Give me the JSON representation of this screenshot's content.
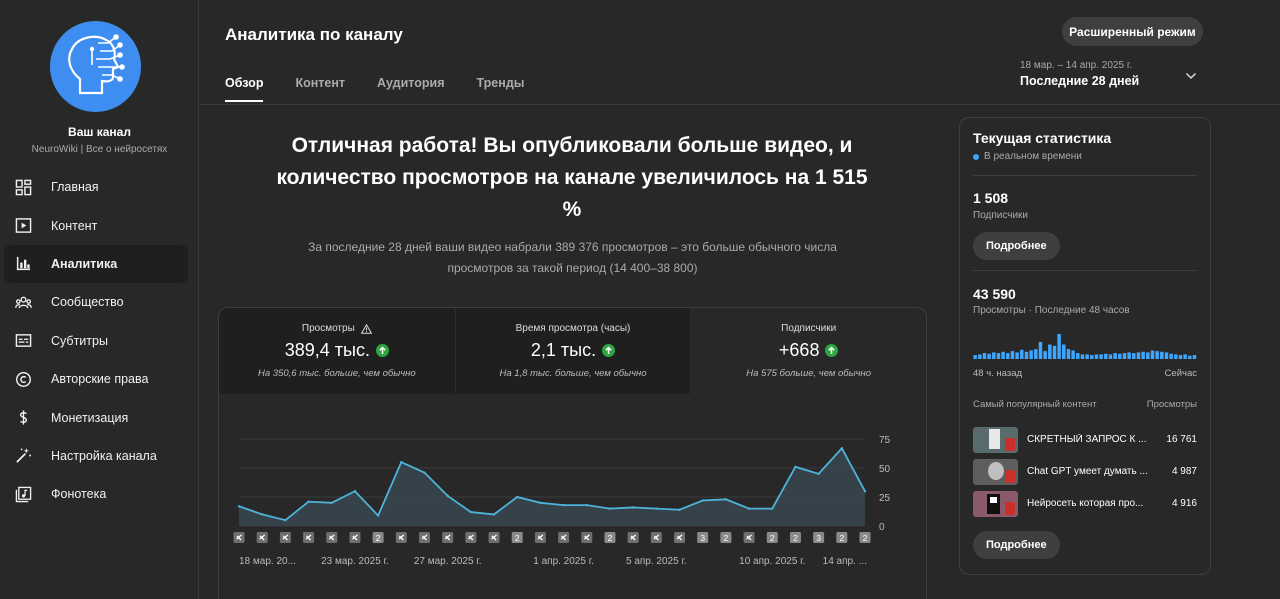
{
  "sidebar": {
    "channel_name": "Ваш канал",
    "channel_sub": "NeuroWiki | Все о нейросетях",
    "items": [
      {
        "label": "Главная",
        "icon": "dashboard-icon"
      },
      {
        "label": "Контент",
        "icon": "content-icon"
      },
      {
        "label": "Аналитика",
        "icon": "analytics-icon",
        "active": true
      },
      {
        "label": "Сообщество",
        "icon": "community-icon"
      },
      {
        "label": "Субтитры",
        "icon": "subtitles-icon"
      },
      {
        "label": "Авторские права",
        "icon": "copyright-icon"
      },
      {
        "label": "Монетизация",
        "icon": "monetization-icon"
      },
      {
        "label": "Настройка канала",
        "icon": "customization-icon"
      },
      {
        "label": "Фонотека",
        "icon": "audio-library-icon"
      }
    ]
  },
  "header": {
    "title": "Аналитика по каналу",
    "tabs": [
      "Обзор",
      "Контент",
      "Аудитория",
      "Тренды"
    ],
    "advanced_button": "Расширенный режим",
    "date_range": "18 мар. – 14 апр. 2025 г.",
    "date_label": "Последние 28 дней"
  },
  "main": {
    "headline": "Отличная работа! Вы опубликовали больше видео, и количество просмотров на канале увеличилось на 1 515 %",
    "subtext": "За последние 28 дней ваши видео набрали 389 376 просмотров – это больше обычного числа просмотров за такой период (14 400–38 800)",
    "metrics": [
      {
        "label": "Просмотры",
        "value": "389,4 тыс.",
        "note": "На 350,6 тыс. больше, чем обычно"
      },
      {
        "label": "Время просмотра (часы)",
        "value": "2,1 тыс.",
        "note": "На 1,8 тыс. больше, чем обычно"
      },
      {
        "label": "Подписчики",
        "value": "+668",
        "note": "На 575 больше, чем обычно"
      }
    ]
  },
  "chart_data": {
    "type": "area",
    "series": [
      {
        "values": [
          17,
          10,
          5,
          21,
          20,
          30,
          9,
          55,
          46,
          26,
          12,
          10,
          25,
          20,
          18,
          18,
          15,
          16,
          15,
          14,
          22,
          23,
          15,
          15,
          51,
          45,
          67,
          30
        ]
      }
    ],
    "yticks": [
      "75",
      "50",
      "25",
      "0"
    ],
    "ylim": [
      0,
      75
    ],
    "xlabels": [
      "18 мар. 20...",
      "23 мар. 2025 г.",
      "27 мар. 2025 г.",
      "1 апр. 2025 г.",
      "5 апр. 2025 г.",
      "10 апр. 2025 г.",
      "14 апр. ..."
    ],
    "upload_markers": [
      "",
      "",
      "",
      "",
      "",
      "",
      "2",
      "",
      "",
      "",
      "",
      "",
      "2",
      "",
      "",
      "",
      "2",
      "",
      "",
      "",
      "3",
      "2",
      "",
      "2",
      "2",
      "3",
      "2",
      "2"
    ],
    "color": "#4fb3d9"
  },
  "realtime": {
    "title": "Текущая статистика",
    "live": "В реальном времени",
    "subs_value": "1 508",
    "subs_label": "Подписчики",
    "more1": "Подробнее",
    "views_value": "43 590",
    "views_label": "Просмотры · Последние 48 часов",
    "spark_values": [
      6,
      7,
      9,
      8,
      10,
      9,
      11,
      9,
      12,
      10,
      14,
      11,
      13,
      15,
      26,
      12,
      22,
      20,
      38,
      22,
      15,
      13,
      9,
      7,
      7,
      6,
      7,
      7,
      8,
      7,
      9,
      8,
      9,
      10,
      9,
      10,
      11,
      10,
      13,
      12,
      11,
      10,
      8,
      7,
      6,
      7,
      5,
      6
    ],
    "axis_left": "48 ч. назад",
    "axis_right": "Сейчас",
    "top_content_label": "Самый популярный контент",
    "top_views_label": "Просмотры",
    "top_content": [
      {
        "title": "СКРЕТНЫЙ ЗАПРОС К ...",
        "views": "16 761"
      },
      {
        "title": "Chat GPT умеет думать ...",
        "views": "4 987"
      },
      {
        "title": "Нейросеть которая про...",
        "views": "4 916"
      }
    ],
    "more2": "Подробнее"
  }
}
